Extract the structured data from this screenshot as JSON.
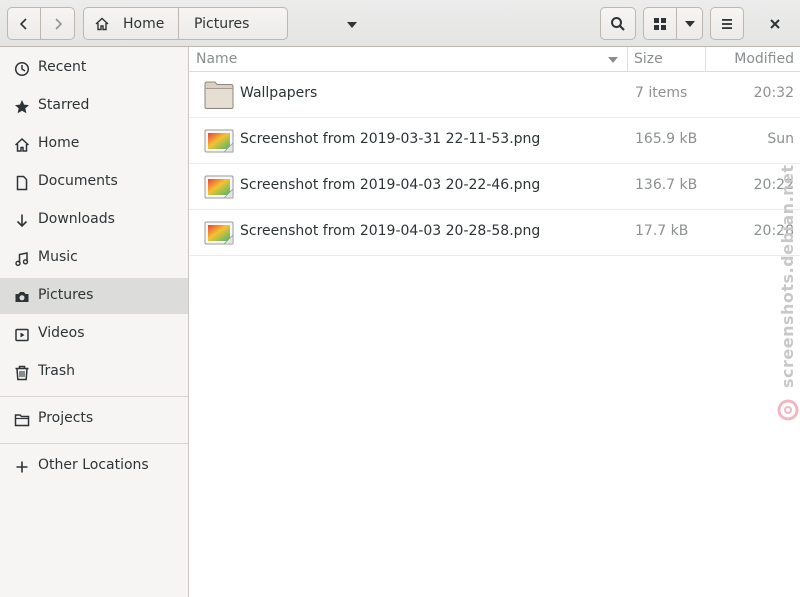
{
  "header": {
    "back_icon": "chevron-left-icon",
    "forward_icon": "chevron-right-icon",
    "path": [
      {
        "label": "Home",
        "icon": "home-icon"
      },
      {
        "label": "Pictures"
      }
    ],
    "path_menu_icon": "caret-down-icon",
    "search_icon": "search-icon",
    "view_icon": "grid-icon",
    "view_menu_icon": "caret-down-icon",
    "menu_icon": "hamburger-icon",
    "close_icon": "close-icon"
  },
  "sidebar": {
    "items": [
      {
        "label": "Recent",
        "icon": "clock-icon"
      },
      {
        "label": "Starred",
        "icon": "star-icon"
      },
      {
        "label": "Home",
        "icon": "home-icon"
      },
      {
        "label": "Documents",
        "icon": "document-icon"
      },
      {
        "label": "Downloads",
        "icon": "download-icon"
      },
      {
        "label": "Music",
        "icon": "music-icon"
      },
      {
        "label": "Pictures",
        "icon": "camera-icon",
        "selected": true
      },
      {
        "label": "Videos",
        "icon": "video-icon"
      },
      {
        "label": "Trash",
        "icon": "trash-icon"
      },
      {
        "label": "Projects",
        "icon": "folder-icon"
      },
      {
        "label": "Other Locations",
        "icon": "plus-icon"
      }
    ]
  },
  "columns": {
    "name": "Name",
    "size": "Size",
    "modified": "Modified"
  },
  "files": [
    {
      "name": "Wallpapers",
      "size": "7 items",
      "modified": "20:32",
      "icon": "folder-icon"
    },
    {
      "name": "Screenshot from 2019-03-31 22-11-53.png",
      "size": "165.9 kB",
      "modified": "Sun",
      "icon": "image-file-icon"
    },
    {
      "name": "Screenshot from 2019-04-03 20-22-46.png",
      "size": "136.7 kB",
      "modified": "20:22",
      "icon": "image-file-icon"
    },
    {
      "name": "Screenshot from 2019-04-03 20-28-58.png",
      "size": "17.7 kB",
      "modified": "20:28",
      "icon": "image-file-icon"
    }
  ],
  "watermark": {
    "text": "screenshots.debian.net"
  }
}
